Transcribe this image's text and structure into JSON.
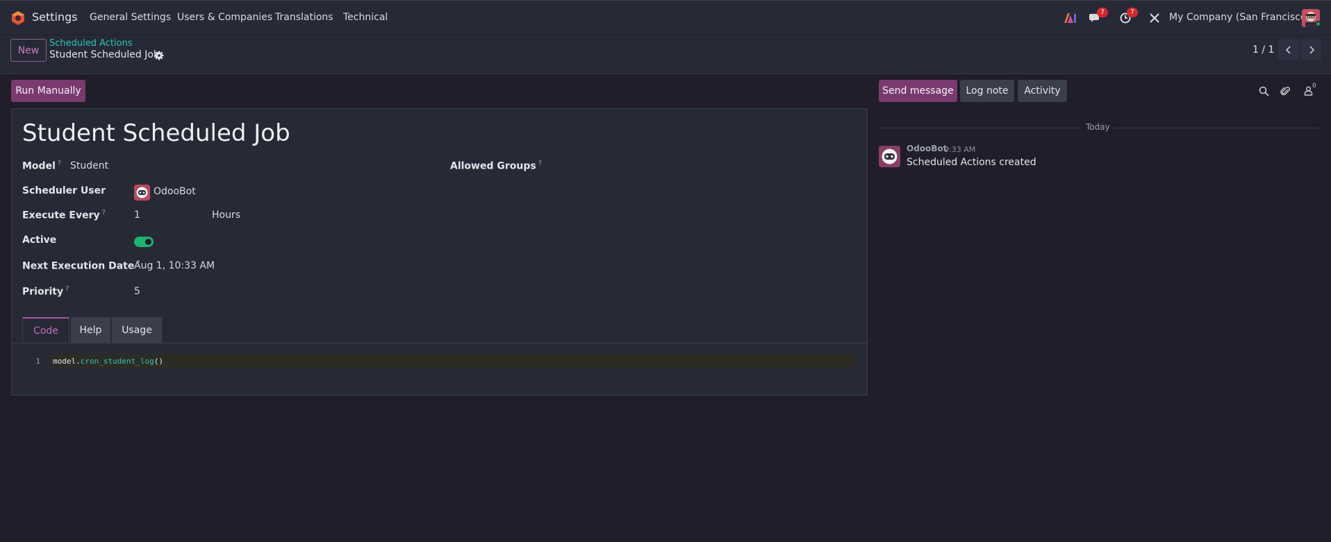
{
  "navbar": {
    "app_name": "Settings",
    "menu": [
      "General Settings",
      "Users & Companies",
      "Translations",
      "Technical"
    ],
    "messages_badge": "7",
    "activity_badge": "7",
    "company": "My Company (San Francisco)"
  },
  "control_panel": {
    "new_label": "New",
    "breadcrumb_parent": "Scheduled Actions",
    "breadcrumb_current": "Student Scheduled Job",
    "pager": "1 / 1"
  },
  "form": {
    "run_manually_label": "Run Manually",
    "title": "Student Scheduled Job",
    "fields": {
      "model_label": "Model",
      "model_value": "Student",
      "allowed_groups_label": "Allowed Groups",
      "scheduler_user_label": "Scheduler User",
      "scheduler_user_value": "OdooBot",
      "execute_every_label": "Execute Every",
      "execute_every_value": "1",
      "execute_every_unit": "Hours",
      "active_label": "Active",
      "active_value": true,
      "next_execution_label": "Next Execution Date",
      "next_execution_value": "Aug 1, 10:33 AM",
      "priority_label": "Priority",
      "priority_value": "5"
    },
    "help_mark": "?",
    "tabs": [
      "Code",
      "Help",
      "Usage"
    ],
    "code": {
      "line_number": "1",
      "object": "model",
      "dot": ".",
      "function": "cron_student_log",
      "parens": "()"
    }
  },
  "chatter": {
    "send_message_label": "Send message",
    "log_note_label": "Log note",
    "activity_label": "Activity",
    "followers_count": "0",
    "date_separator": "Today",
    "message": {
      "author": "OdooBot",
      "time": "9:33 AM",
      "body": "Scheduled Actions created"
    }
  },
  "colors": {
    "accent": "#7a3a70",
    "link": "#2ec4b6",
    "toggle_on": "#1bb56b",
    "badge": "#d9262e"
  }
}
